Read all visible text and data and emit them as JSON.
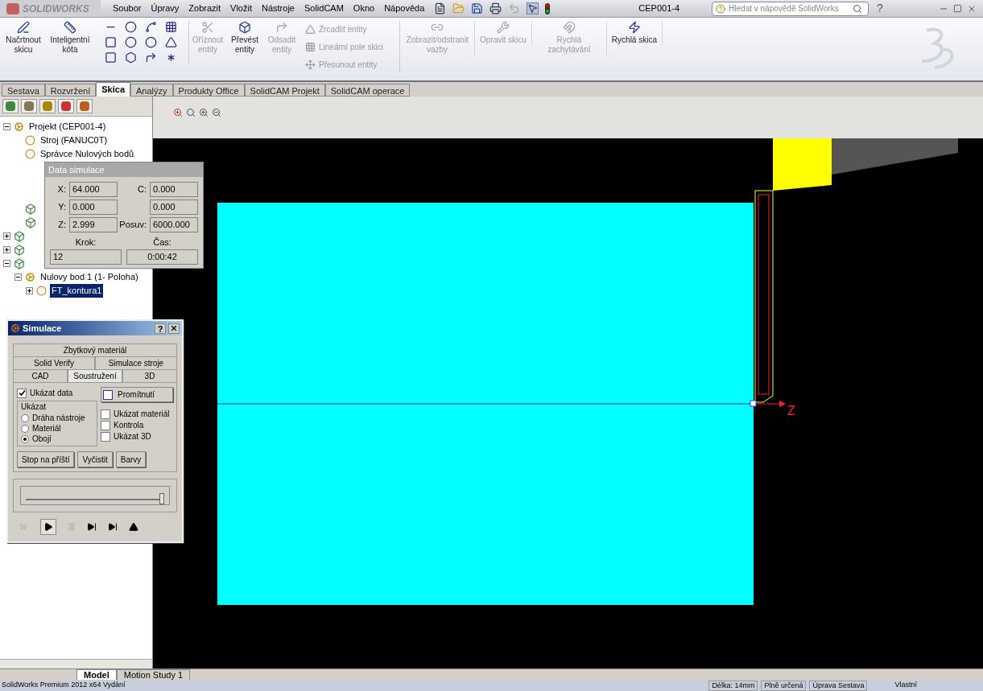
{
  "app": {
    "logo": "SOLIDWORKS",
    "menu": [
      "Soubor",
      "Úpravy",
      "Zobrazit",
      "Vložit",
      "Nástroje",
      "SolidCAM",
      "Okno",
      "Nápověda"
    ],
    "document_title": "CEP001-4",
    "search": {
      "placeholder": "Hledat v nápovědě SolidWorks"
    },
    "help": "?"
  },
  "ribbon": {
    "large_buttons": [
      {
        "label": "Načrtnout skicu",
        "disabled": false,
        "kind": "sketch"
      },
      {
        "label": "Inteligentní kóta",
        "disabled": false,
        "kind": "dimension"
      },
      {
        "label": "Oříznout entity",
        "disabled": true,
        "kind": "trim"
      },
      {
        "label": "Převést entity",
        "disabled": false,
        "kind": "convert"
      },
      {
        "label": "Odsadit entity",
        "disabled": true,
        "kind": "offset"
      }
    ],
    "small_buttons": [
      {
        "label": "Zrcadlit entity",
        "disabled": true
      },
      {
        "label": "Lineární pole skici",
        "disabled": true
      },
      {
        "label": "Přesunout entity",
        "disabled": true
      }
    ],
    "right_buttons": [
      {
        "label": "Zobrazit/odstranit vazby",
        "disabled": true
      },
      {
        "label": "Opravit skicu",
        "disabled": true
      },
      {
        "label": "Rychlá zachytávání",
        "disabled": true
      },
      {
        "label": "Rychlá skica",
        "disabled": false
      }
    ]
  },
  "command_tabs": [
    {
      "label": "Sestava",
      "selected": false
    },
    {
      "label": "Rozvržení",
      "selected": false
    },
    {
      "label": "Skica",
      "selected": true
    },
    {
      "label": "Analýzy",
      "selected": false
    },
    {
      "label": "Produkty Office",
      "selected": false
    },
    {
      "label": "SolidCAM Projekt",
      "selected": false
    },
    {
      "label": "SolidCAM operace",
      "selected": false
    }
  ],
  "feature_tree": {
    "items": [
      {
        "kind": "text",
        "label": "Projekt (CEP001-4)",
        "expanded": true,
        "selected": false,
        "children": [
          {
            "kind": "text",
            "label": "Stroj (FANUC0T)",
            "selected": false
          },
          {
            "kind": "text",
            "label": "Správce Nulových bodů",
            "selected": false
          },
          {
            "kind": "icon"
          },
          {
            "kind": "icon"
          }
        ]
      },
      {
        "kind": "icon",
        "expanded": false
      },
      {
        "kind": "icon",
        "expanded": false
      },
      {
        "kind": "icon",
        "expanded": true,
        "children": [
          {
            "kind": "text",
            "label": "Nulovy bod 1 (1- Poloha)",
            "expanded": true,
            "selected": false,
            "children": [
              {
                "kind": "text",
                "label": "FT_kontura1",
                "expanded": false,
                "selected": true
              }
            ]
          }
        ]
      }
    ]
  },
  "data_simulation": {
    "title": "Data simulace",
    "rows": [
      [
        {
          "label": "X:",
          "value": "64.000"
        },
        {
          "label": "C:",
          "value": "0.000"
        }
      ],
      [
        {
          "label": "Y:",
          "value": "0.000"
        },
        {
          "value": "0.000"
        }
      ],
      [
        {
          "label": "Z:",
          "value": "2.999"
        },
        {
          "label": "Posuv:",
          "value": "6000.000"
        }
      ]
    ],
    "bottom": [
      {
        "label": "Krok:",
        "value": "12"
      },
      {
        "label": "Čas:",
        "value": "0:00:42"
      }
    ]
  },
  "simulation": {
    "title": "Simulace",
    "help": "?",
    "tab_rows": [
      [
        {
          "label": "Zbytkový materiál",
          "selected": false
        }
      ],
      [
        {
          "label": "Solid Verify",
          "selected": false
        },
        {
          "label": "Simulace stroje",
          "selected": false
        }
      ],
      [
        {
          "label": "CAD",
          "selected": false
        },
        {
          "label": "Soustružení",
          "selected": true
        },
        {
          "label": "3D",
          "selected": false
        }
      ]
    ],
    "show_data": {
      "label": "Ukázat data",
      "checked": true
    },
    "projection": {
      "label": "Promítnutí",
      "checked": false
    },
    "show_group": {
      "title": "Ukázat",
      "options": [
        {
          "label": "Dráha nástroje",
          "selected": false
        },
        {
          "label": "Materiál",
          "selected": false
        },
        {
          "label": "Obojí",
          "selected": true
        }
      ]
    },
    "checkboxes": [
      {
        "label": "Ukázat materiál",
        "checked": false
      },
      {
        "label": "Kontrola",
        "checked": false
      },
      {
        "label": "Ukázat 3D",
        "checked": false
      }
    ],
    "buttons": [
      "Stop na příští",
      "Vyčistit",
      "Barvy"
    ],
    "speed": {
      "level": 0.97
    }
  },
  "viewport": {
    "axis_label": "Z"
  },
  "bottom_tabs": [
    {
      "label": "Model",
      "selected": true
    },
    {
      "label": "Motion Study 1",
      "selected": false
    }
  ],
  "status_bar": {
    "product": "SolidWorks Premium 2012 x64 Vydání",
    "fields": [
      "Délka: 14mm",
      "Plně určená",
      "Úprava Sestava"
    ],
    "units": "Vlastní"
  }
}
